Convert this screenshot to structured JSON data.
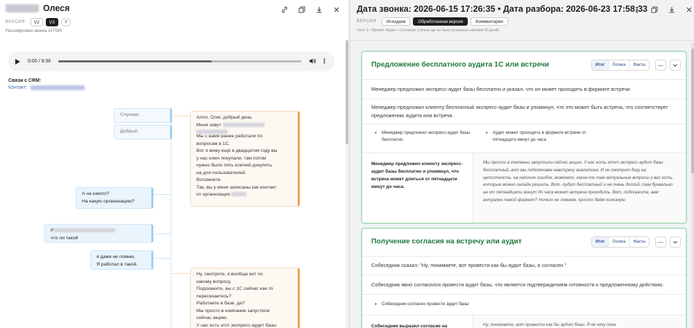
{
  "left": {
    "contact_name": "Олеся",
    "version_label": "ВЕРСИЯ",
    "versions": [
      "V2",
      "V3",
      "?"
    ],
    "transcript_id": "Расшифровка звонка 247565",
    "audio": {
      "time": "0:00 / 9:36",
      "progress": 0.63
    },
    "crm_title": "Связи с CRM:",
    "crm_contact_label": "Контакт:",
    "messages": [
      {
        "side": "client",
        "lines": [
          "Слушаю."
        ]
      },
      {
        "side": "client",
        "lines": [
          "Добрый."
        ]
      },
      {
        "side": "manager",
        "lines": [
          "Алло, Олег, добрый день.",
          "Меня зовут",
          "",
          "Мы с вами ранее работали по",
          "вопросам в 1С.",
          "Вот я вижу ещё в двадцатом году вы",
          "у нас ключ покупали, там потом",
          "нужно было пять ключей докупить",
          "на для пользователей.",
          "Вспомните.",
          "Так, вы у меня записаны как контакт",
          "от организации"
        ]
      },
      {
        "side": "client",
        "lines": [
          "А на какого?",
          "На какую организацию?"
        ]
      },
      {
        "side": "client",
        "lines": [
          "Р",
          "что ли такой"
        ]
      },
      {
        "side": "client",
        "lines": [
          "я даже не помню.",
          "Я работал в такой."
        ]
      },
      {
        "side": "manager",
        "lines": [
          "Ну, смотрите, я вообще вот по",
          "какому вопросу.",
          "Подскажите, вы с 1С сейчас как-то",
          "пересекаетесь?",
          "Работаете в базе, да?",
          "Мы просто в компании запустили",
          "сейчас акцию.",
          "У нас есть этот экспресс-аудит базы"
        ]
      }
    ]
  },
  "right": {
    "title": "Дата звонка: 2026-06-15 17:26:35 • Дата разбора: 2026-06-23 17:58:33",
    "version_label": "ВЕРСИЯ",
    "versions": [
      "Исходник",
      "Обработанная версия",
      "Комментарии"
    ],
    "breadcrumb": "Теги: 2 • Промпт Аудит + Согласие (только где не было успешных звонков 30 дней)",
    "tabs": [
      "Итог",
      "Логика",
      "Факты"
    ],
    "cards": [
      {
        "title": "Предложение бесплатного аудита 1С или встречи",
        "summary": "Менеджер предложил экспресс-аудит базы бесплатно и указал, что он может проходить в формате встречи.",
        "logic": "Менеджер предложил клиенту бесплатный экспресс-аудит базы и упомянул, что это может быть встреча, что соответствует предложению аудита или встречи.",
        "facts": [
          "Менеджер предложил экспресс-аудит базы бесплатно",
          "Аудит может проходить в формате встречи от пятнадцати минут до часа"
        ],
        "evidence_label": "Менеджер предложил клиенту экспресс-аудит базы бесплатно и упомянул, что встреча может длиться от пятнадцати минут до часа.",
        "evidence_quote": "Мы просто в компании запустили сейчас акцию. У нас есть этот экспресс-аудит базы бесплатный, вот мы подключаем навстречу аналитика. И он смотрит базу на целостность, на наличие ошибок, возможно, какие-то там актуальные вопросы у вас есть, которые можно онлайн решить. Вот. Аудит бесплатный и не очень долгий, там буквально на от пятнадцати минут до часа может встреча проходить. Вот, подскажите, вам актуален такой формат? Ничего не ломаем, просто даём полезную."
      },
      {
        "title": "Получение согласия на встречу или аудит",
        "summary": "Собеседник сказал: \"Ну, понимаете, вот провести как бы аудит базы, я согласен.\"",
        "logic": "Собеседник явно согласился провести аудит базы, что является подтверждением готовности к предложенному действию.",
        "facts": [
          "Собеседник согласен провести аудит базы"
        ],
        "evidence_label": "Собеседник выразил согласие на",
        "evidence_quote": "Ну, понимаете, вот провести как бы аудит базы. Я не хочу пока"
      }
    ]
  }
}
